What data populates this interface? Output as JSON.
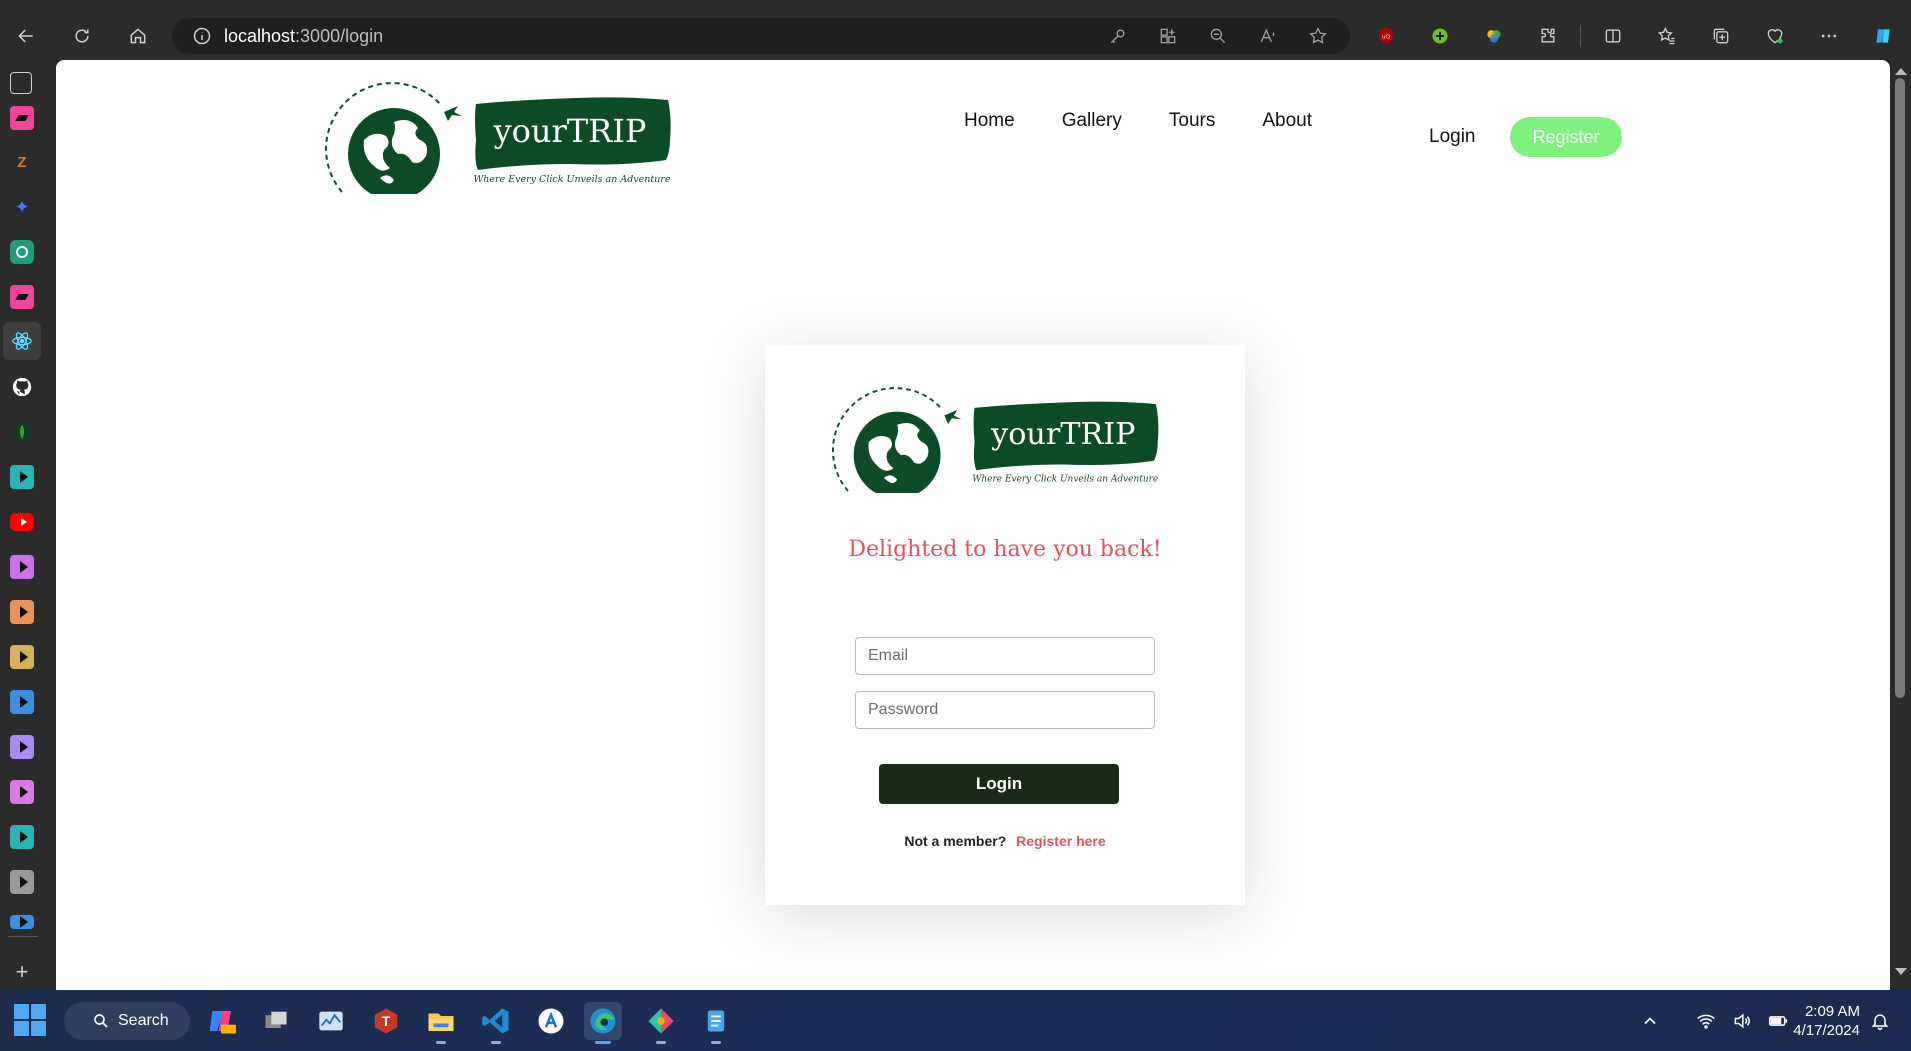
{
  "browser": {
    "url_host": "localhost",
    "url_path": ":3000/login"
  },
  "site": {
    "brand": "yourTRIP",
    "tagline": "Where Every Click Unveils an Adventure",
    "nav": {
      "home": "Home",
      "gallery": "Gallery",
      "tours": "Tours",
      "about": "About",
      "login": "Login",
      "register": "Register"
    }
  },
  "login_card": {
    "title": "Delighted to have you back!",
    "email_placeholder": "Email",
    "password_placeholder": "Password",
    "login_button": "Login",
    "not_member": "Not a member?",
    "register_link": "Register here"
  },
  "taskbar": {
    "search_label": "Search",
    "time": "2:09 AM",
    "date": "4/17/2024"
  },
  "colors": {
    "brand_green": "#0d4a26",
    "accent_red": "#e0535b",
    "register_green": "#7ef27e",
    "login_button": "#1b2a18"
  }
}
